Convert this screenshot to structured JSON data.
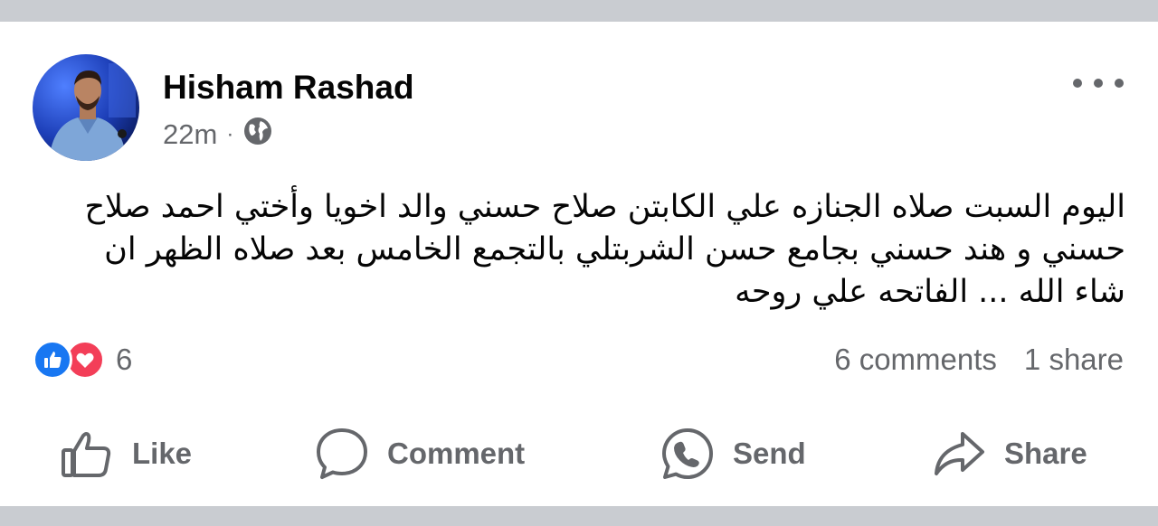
{
  "post": {
    "author_name": "Hisham Rashad",
    "time": "22m",
    "separator": "·",
    "privacy_icon": "globe-icon",
    "text_lines": [
      "اليوم السبت صلاه الجنازه علي الكابتن صلاح حسني والد اخويا وأختي احمد صلاح",
      "حسني و هند حسني بجامع حسن الشربتلي بالتجمع الخامس بعد صلاه الظهر ان",
      "شاء الله ... الفاتحه علي روحه"
    ]
  },
  "reactions": {
    "icons": [
      "like-reaction-icon",
      "love-reaction-icon"
    ],
    "count": "6"
  },
  "stats": {
    "comments": "6 comments",
    "shares": "1 share"
  },
  "actions": [
    {
      "label": "Like",
      "icon": "thumbs-up-icon"
    },
    {
      "label": "Comment",
      "icon": "comment-bubble-icon"
    },
    {
      "label": "Send",
      "icon": "whatsapp-icon"
    },
    {
      "label": "Share",
      "icon": "share-arrow-icon"
    }
  ],
  "colors": {
    "secondary_text": "#65676b",
    "primary_text": "#050505",
    "like_blue": "#1877f2",
    "love_red": "#f33e58",
    "band_gray": "#c9ccd1"
  }
}
